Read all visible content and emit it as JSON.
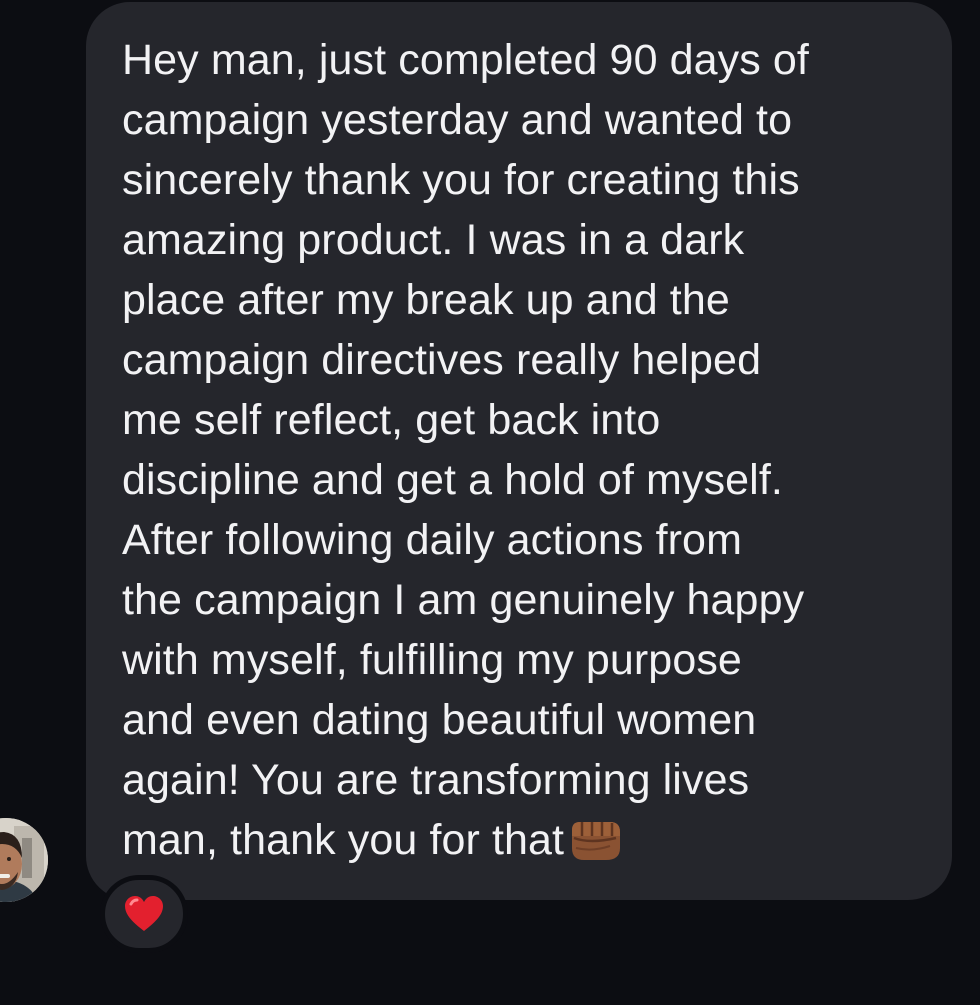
{
  "message": {
    "lines": [
      "Hey man, just completed 90 days of",
      "campaign yesterday and wanted to",
      "sincerely thank you for creating this",
      "amazing product. I was in a dark",
      "place after my break up and the",
      "campaign directives really helped",
      "me self reflect, get back into",
      "discipline and get a hold of myself.",
      "After following daily actions from",
      "the campaign I am genuinely happy",
      "with myself, fulfilling my purpose",
      "and even dating beautiful women",
      "again! You are transforming lives",
      "man, thank you for that"
    ],
    "trailing_emoji": "oncoming-fist-medium-dark-skin",
    "reaction": "red-heart"
  },
  "colors": {
    "background": "#0c0d12",
    "bubble": "#25262c",
    "text": "#f2f2f4",
    "heart": "#e3202e",
    "fist": "#8a5232"
  }
}
